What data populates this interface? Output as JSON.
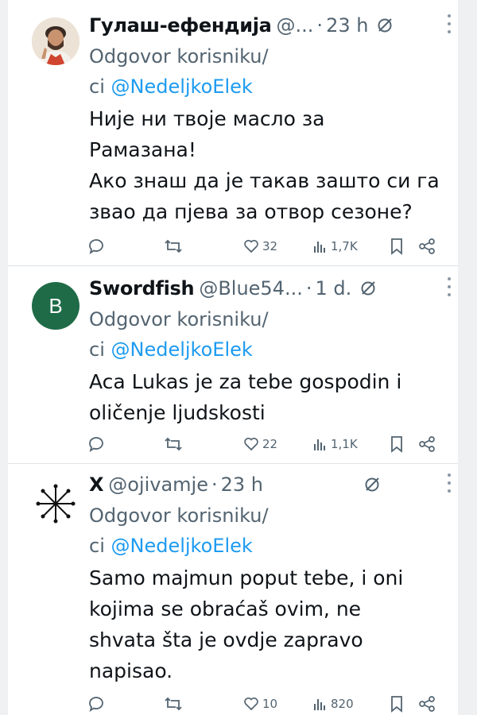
{
  "tweets": [
    {
      "name": "Гулаш-ефендија",
      "handle": "@...",
      "time": "23 h",
      "reply_prefix": "Odgovor korisniku/",
      "reply_ci": "ci ",
      "reply_mention": "@NedeljkoElek",
      "lines": [
        "Није ни твоје масло за",
        "Рамазана!",
        "Ако знаш да је такав зашто си га",
        "звао да пјева за отвор сезоне?"
      ],
      "likes": "32",
      "views": "1,7K",
      "avatar_icon": "user-photo-avatar"
    },
    {
      "name": "Swordfish",
      "handle": "@Blue54...",
      "time": "1 d.",
      "reply_prefix": "Odgovor korisniku/",
      "reply_ci": "ci ",
      "reply_mention": "@NedeljkoElek",
      "lines": [
        "Aca Lukas je za tebe gospodin i",
        "oličenje ljudskosti"
      ],
      "likes": "22",
      "views": "1,1K",
      "avatar_letter": "B",
      "avatar_color": "#1f6b47"
    },
    {
      "name": "X",
      "handle": "@ojivamje",
      "time": "23 h",
      "reply_prefix": "Odgovor korisniku/",
      "reply_ci": "ci ",
      "reply_mention": "@NedeljkoElek",
      "lines": [
        "Samo majmun poput tebe, i oni",
        "kojima se obraćaš ovim, ne",
        "shvata šta je ovdje zapravo",
        "napisao."
      ],
      "likes": "10",
      "views": "820",
      "avatar_icon": "star-glyph-avatar"
    }
  ],
  "colors": {
    "accent": "#1d9bf0",
    "secondary": "#536471"
  }
}
